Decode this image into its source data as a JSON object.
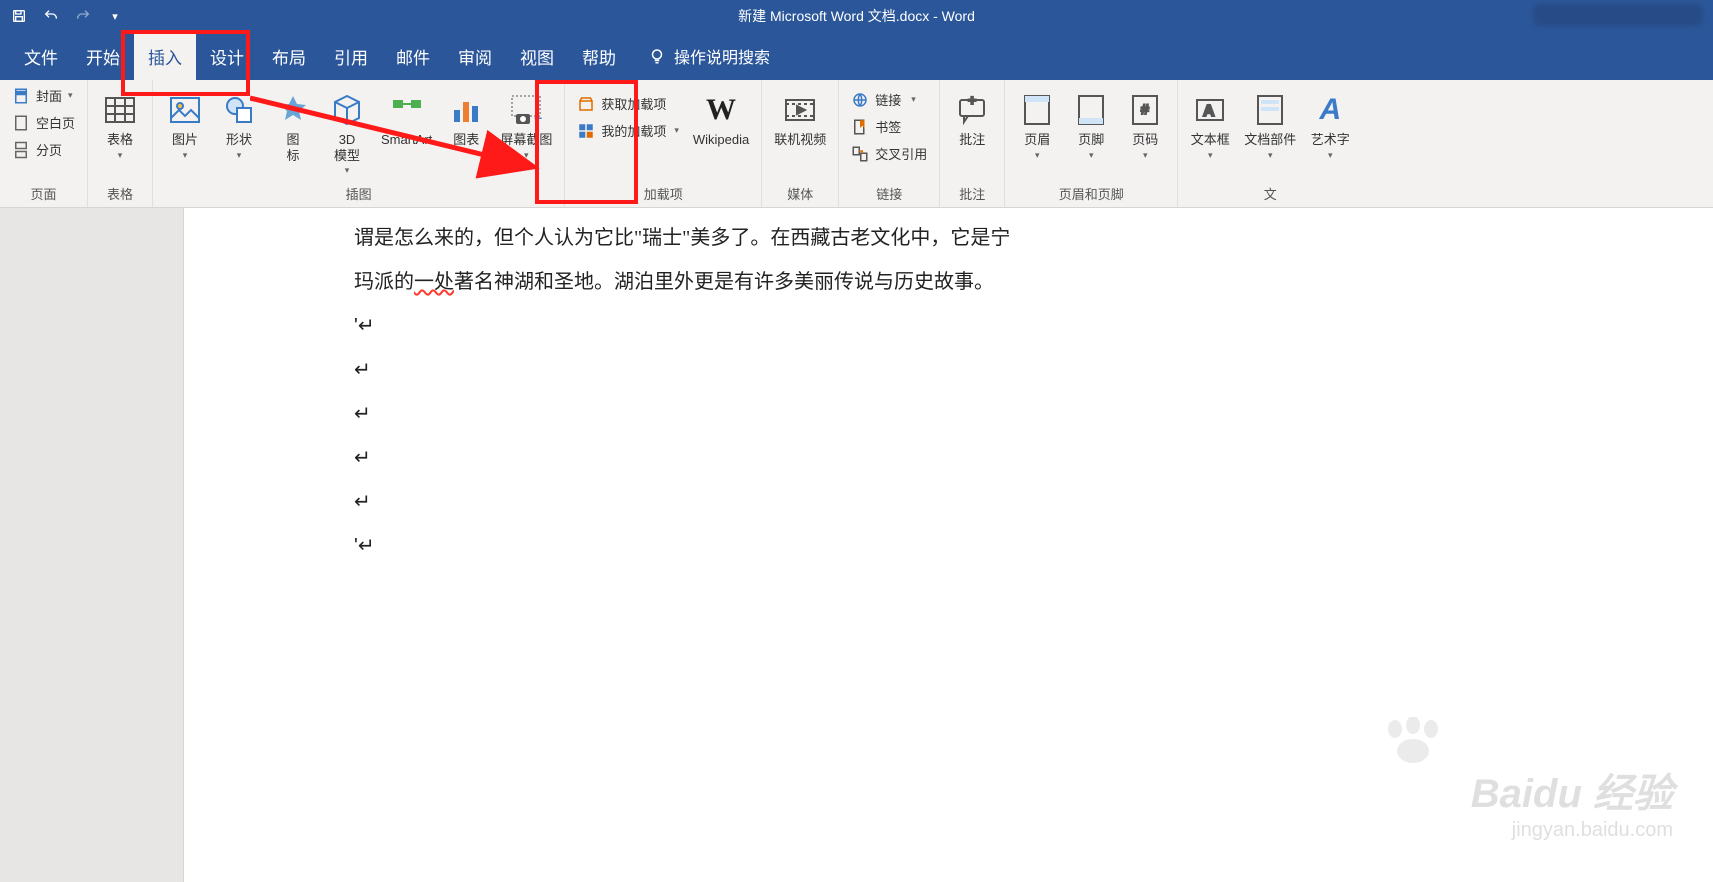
{
  "app": {
    "title": "新建 Microsoft Word 文档.docx  -  Word"
  },
  "qat": {
    "save": "save-icon",
    "undo": "undo-icon",
    "redo": "redo-icon",
    "customize": "chevron-down-icon"
  },
  "tabs": {
    "items": [
      {
        "id": "file",
        "label": "文件"
      },
      {
        "id": "home",
        "label": "开始"
      },
      {
        "id": "insert",
        "label": "插入"
      },
      {
        "id": "design",
        "label": "设计"
      },
      {
        "id": "layout",
        "label": "布局"
      },
      {
        "id": "references",
        "label": "引用"
      },
      {
        "id": "mailings",
        "label": "邮件"
      },
      {
        "id": "review",
        "label": "审阅"
      },
      {
        "id": "view",
        "label": "视图"
      },
      {
        "id": "help",
        "label": "帮助"
      }
    ],
    "active": "insert",
    "tell_me": "操作说明搜索"
  },
  "ribbon": {
    "groups": [
      {
        "id": "pages",
        "label": "页面",
        "items": [
          {
            "id": "cover",
            "label": "封面",
            "icon": "cover-icon",
            "drop": true,
            "small": true
          },
          {
            "id": "blank",
            "label": "空白页",
            "icon": "blank-page-icon",
            "small": true
          },
          {
            "id": "break",
            "label": "分页",
            "icon": "page-break-icon",
            "small": true
          }
        ]
      },
      {
        "id": "tables",
        "label": "表格",
        "items": [
          {
            "id": "table",
            "label": "表格",
            "icon": "table-icon",
            "drop": true
          }
        ]
      },
      {
        "id": "illustrations",
        "label": "插图",
        "items": [
          {
            "id": "pictures",
            "label": "图片",
            "icon": "picture-icon",
            "drop": true
          },
          {
            "id": "shapes",
            "label": "形状",
            "icon": "shapes-icon",
            "drop": true
          },
          {
            "id": "icons",
            "label": "图\n标",
            "icon": "icons-icon"
          },
          {
            "id": "model3d",
            "label": "3D\n模型",
            "icon": "cube-icon",
            "drop": true
          },
          {
            "id": "smartart",
            "label": "SmartArt",
            "icon": "smartart-icon"
          },
          {
            "id": "chart",
            "label": "图表",
            "icon": "chart-icon"
          },
          {
            "id": "screenshot",
            "label": "屏幕截图",
            "icon": "screenshot-icon",
            "drop": true
          }
        ]
      },
      {
        "id": "addins",
        "label": "加载项",
        "items": [
          {
            "id": "getaddins",
            "label": "获取加载项",
            "icon": "store-icon",
            "small": true
          },
          {
            "id": "myaddins",
            "label": "我的加载项",
            "icon": "addins-icon",
            "small": true,
            "drop": true
          },
          {
            "id": "wikipedia",
            "label": "Wikipedia",
            "icon": "wikipedia-icon"
          }
        ]
      },
      {
        "id": "media",
        "label": "媒体",
        "items": [
          {
            "id": "onlinevideo",
            "label": "联机视频",
            "icon": "video-icon"
          }
        ]
      },
      {
        "id": "links",
        "label": "链接",
        "items": [
          {
            "id": "link",
            "label": "链接",
            "icon": "link-icon",
            "small": true,
            "drop": true
          },
          {
            "id": "bookmark",
            "label": "书签",
            "icon": "bookmark-icon",
            "small": true
          },
          {
            "id": "crossref",
            "label": "交叉引用",
            "icon": "crossref-icon",
            "small": true
          }
        ]
      },
      {
        "id": "comments",
        "label": "批注",
        "items": [
          {
            "id": "comment",
            "label": "批注",
            "icon": "comment-icon"
          }
        ]
      },
      {
        "id": "headerfooter",
        "label": "页眉和页脚",
        "items": [
          {
            "id": "header",
            "label": "页眉",
            "icon": "header-icon",
            "drop": true
          },
          {
            "id": "footer",
            "label": "页脚",
            "icon": "footer-icon",
            "drop": true
          },
          {
            "id": "pagenum",
            "label": "页码",
            "icon": "pagenum-icon",
            "drop": true
          }
        ]
      },
      {
        "id": "text",
        "label": "文",
        "items": [
          {
            "id": "textbox",
            "label": "文本框",
            "icon": "textbox-icon",
            "drop": true
          },
          {
            "id": "quickparts",
            "label": "文档部件",
            "icon": "quickparts-icon",
            "drop": true
          },
          {
            "id": "wordart",
            "label": "艺术字",
            "icon": "wordart-icon",
            "drop": true
          }
        ]
      }
    ]
  },
  "document": {
    "lines": [
      "谓是怎么来的，但个人认为它比\"瑞士\"美多了。在西藏古老文化中，它是宁",
      "玛派的一处著名神湖和圣地。湖泊里外更是有许多美丽传说与历史故事。"
    ],
    "quote_mark": "'",
    "para_mark": "↵",
    "wavy_word": "一处"
  },
  "watermark": {
    "brand": "Baidu 经验",
    "url": "jingyan.baidu.com"
  }
}
